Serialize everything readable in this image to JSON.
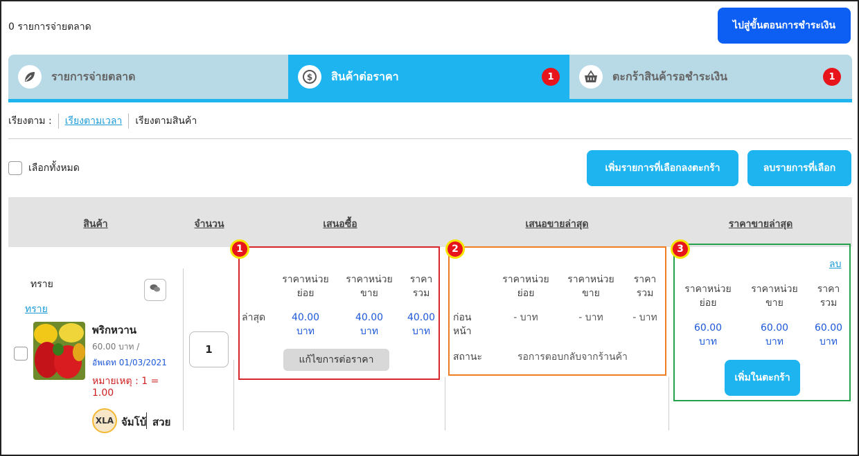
{
  "header": {
    "count_label": "0 รายการจ่ายตลาด",
    "checkout_button": "ไปสู่ขั้นตอนการชำระเงิน"
  },
  "tabs": [
    {
      "label": "รายการจ่ายตลาด",
      "icon": "leaf-icon",
      "badge": ""
    },
    {
      "label": "สินค้าต่อราคา",
      "icon": "dollar-coin-icon",
      "badge": "1"
    },
    {
      "label": "ตะกร้าสินค้ารอชำระเงิน",
      "icon": "basket-icon",
      "badge": "1"
    }
  ],
  "sort": {
    "label": "เรียงตาม :",
    "by_time": "เรียงตามเวลา",
    "by_product": "เรียงตามสินค้า"
  },
  "actions": {
    "select_all": "เลือกทั้งหมด",
    "add_selected": "เพิ่มรายการที่เลือกลงตะกร้า",
    "delete_selected": "ลบรายการที่เลือก"
  },
  "table_headers": {
    "product": "สินค้า",
    "quantity": "จำนวน",
    "offer": "เสนอซื้อ",
    "latest_offer": "เสนอขายล่าสุด",
    "latest_price": "ราคาขายล่าสุด"
  },
  "row": {
    "group_name": "ทราย",
    "group_link": "ทราย",
    "product_name": "พริกหวาน",
    "unit_price": "60.00 บาท /",
    "updated": "อัพเดท 01/03/2021",
    "note_line1": "หมายเหตุ : 1 =",
    "note_line2": "1.00",
    "seller_avatar": "XLA",
    "seller_name": "จัมโบ้",
    "seller_tag": "สวย",
    "quantity": "1",
    "offer": {
      "marker": "1",
      "h_unit_a": "ราคาหน่วย",
      "h_unit_a2": "ย่อย",
      "h_unit_b": "ราคาหน่วย",
      "h_unit_b2": "ขาย",
      "h_total": "ราคา",
      "h_total2": "รวม",
      "row_label": "ล่าสุด",
      "v1": "40.00",
      "v2": "40.00",
      "v3": "40.00",
      "unit": "บาท",
      "edit_button": "แก้ไขการต่อราคา"
    },
    "latest_offer": {
      "marker": "2",
      "h_unit_a": "ราคาหน่วย",
      "h_unit_a2": "ย่อย",
      "h_unit_b": "ราคาหน่วย",
      "h_unit_b2": "ขาย",
      "h_total": "ราคา",
      "h_total2": "รวม",
      "row_label1": "ก่อน",
      "row_label2": "หน้า",
      "v1": "- บาท",
      "v2": "- บาท",
      "v3": "- บาท",
      "status_label": "สถานะ",
      "status_value": "รอการตอบกลับจากร้านค้า"
    },
    "latest_price": {
      "marker": "3",
      "delete_link": "ลบ",
      "h_unit_a": "ราคาหน่วย",
      "h_unit_a2": "ย่อย",
      "h_unit_b": "ราคาหน่วย",
      "h_unit_b2": "ขาย",
      "h_total": "ราคา",
      "h_total2": "รวม",
      "v1": "60.00",
      "v2": "60.00",
      "v3": "60.00",
      "unit": "บาท",
      "add_button": "เพิ่มในตะกร้า"
    }
  },
  "colors": {
    "primary_blue": "#0d5ef2",
    "cyan": "#1db4f0",
    "tab_inactive": "#b8d9e6",
    "badge_red": "#e8141b",
    "box1": "#d6262b",
    "box2": "#ef7d22",
    "box3": "#23a04a"
  }
}
